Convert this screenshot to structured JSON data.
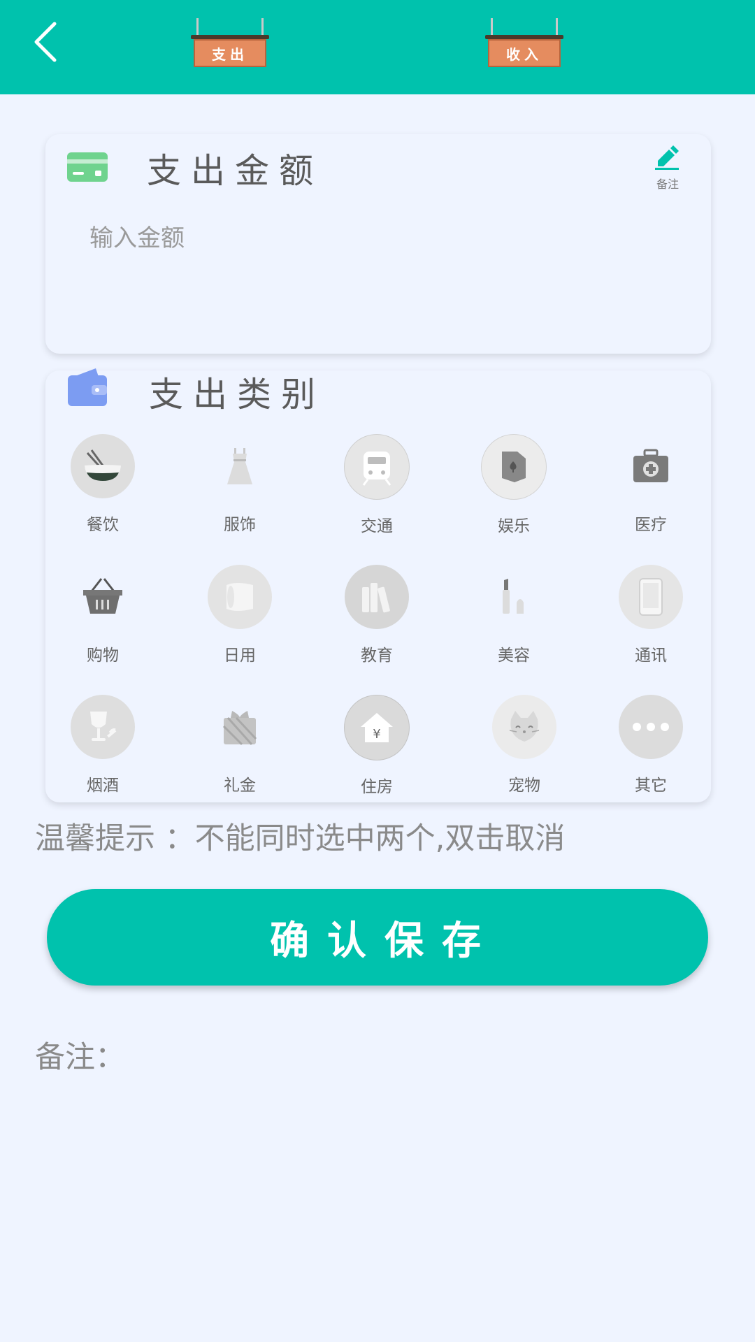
{
  "colors": {
    "accent": "#00c2ad",
    "background": "#eff4ff",
    "sign_board": "#e58c5f"
  },
  "header": {
    "back_icon": "chevron-left-icon",
    "tab_expense": "支出",
    "tab_income": "收入"
  },
  "amount_card": {
    "icon": "credit-card-icon",
    "title": "支出金额",
    "memo_icon": "pencil-icon",
    "memo_label": "备注",
    "placeholder": "输入金额",
    "value": ""
  },
  "category_card": {
    "icon": "wallet-icon",
    "title": "支出类别",
    "categories": [
      {
        "label": "餐饮",
        "icon": "bowl-icon"
      },
      {
        "label": "服饰",
        "icon": "dress-icon"
      },
      {
        "label": "交通",
        "icon": "train-icon"
      },
      {
        "label": "娱乐",
        "icon": "playing-card-icon"
      },
      {
        "label": "医疗",
        "icon": "medical-kit-icon"
      },
      {
        "label": "购物",
        "icon": "basket-icon"
      },
      {
        "label": "日用",
        "icon": "tissue-roll-icon"
      },
      {
        "label": "教育",
        "icon": "books-icon"
      },
      {
        "label": "美容",
        "icon": "lipstick-icon"
      },
      {
        "label": "通讯",
        "icon": "phone-icon"
      },
      {
        "label": "烟酒",
        "icon": "wine-glass-icon"
      },
      {
        "label": "礼金",
        "icon": "gift-icon"
      },
      {
        "label": "住房",
        "icon": "house-icon"
      },
      {
        "label": "宠物",
        "icon": "cat-icon"
      },
      {
        "label": "其它",
        "icon": "more-dots-icon"
      }
    ]
  },
  "tip": "温馨提示 ：不能同时选中两个,双击取消",
  "save_button": "确认保存",
  "note_label": "备注："
}
